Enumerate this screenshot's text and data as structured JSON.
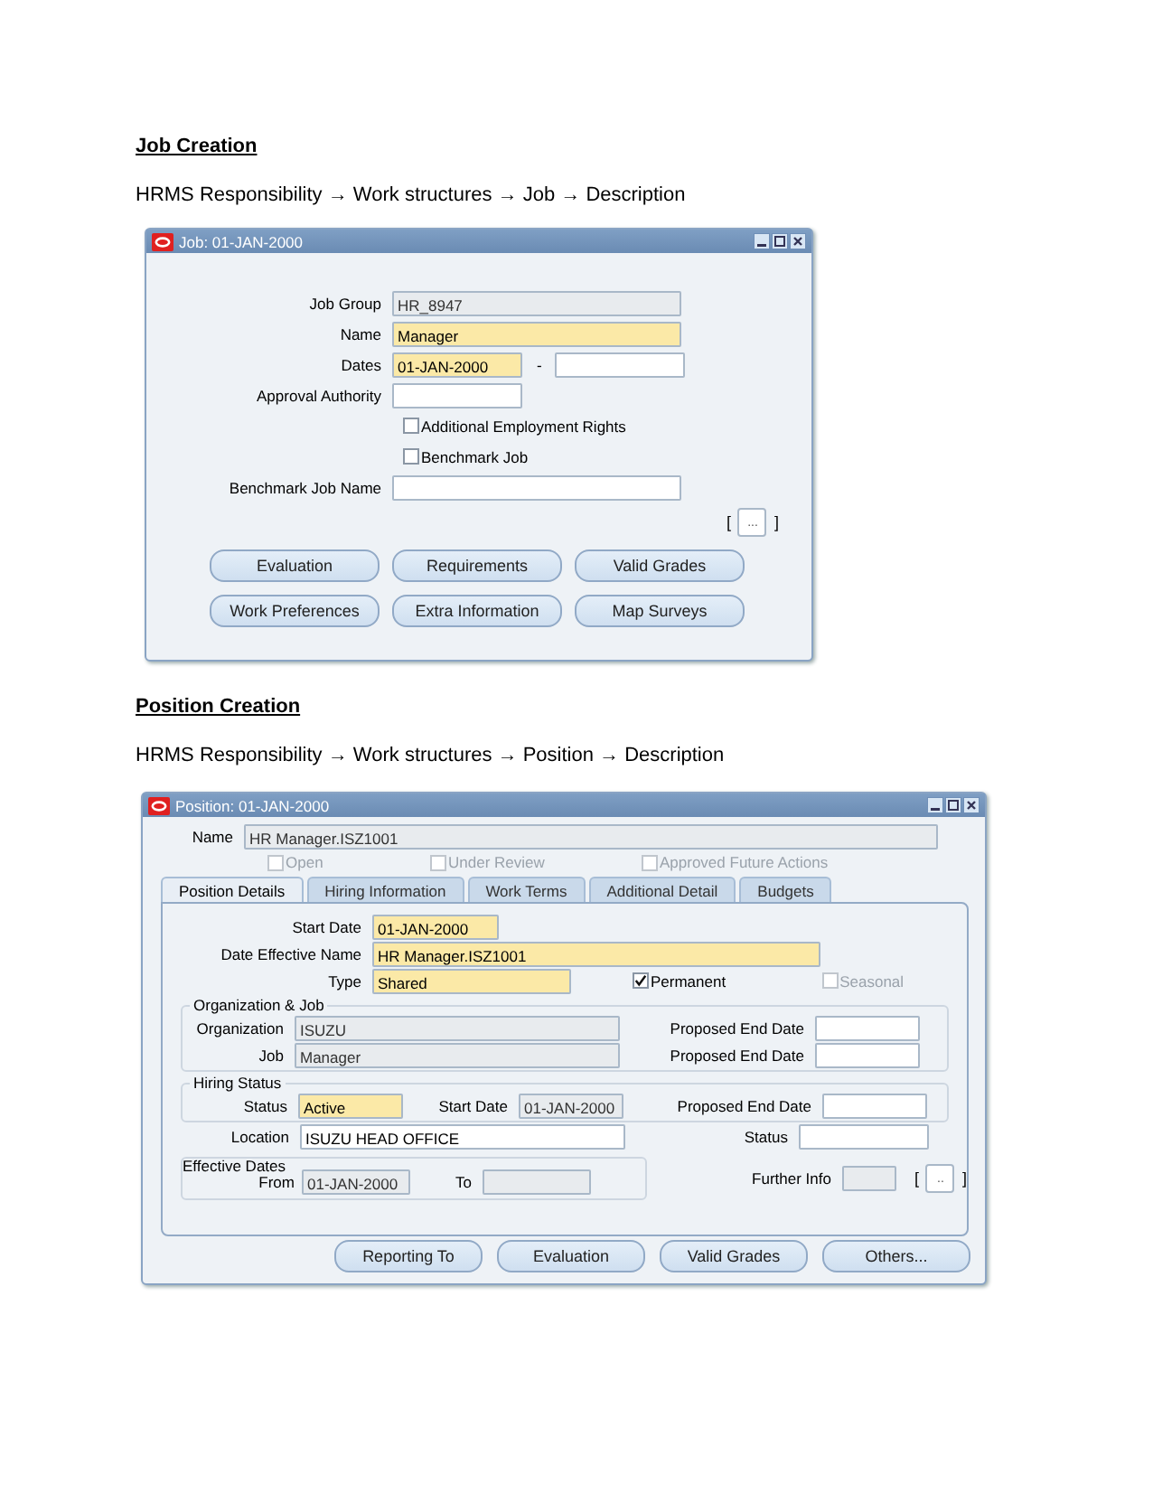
{
  "job_section": {
    "heading": "Job Creation",
    "path": "HRMS Responsibility → Work structures → Job → Description"
  },
  "job_window": {
    "title": "Job: 01-JAN-2000",
    "fields": [
      {
        "label": "Job Group",
        "value": "HR_8947",
        "kind": "readonly"
      },
      {
        "label": "Name",
        "value": "Manager",
        "kind": "required"
      },
      {
        "label": "Dates",
        "value": "01-JAN-2000",
        "kind": "required"
      },
      {
        "kind": "normal"
      },
      {
        "label": "Approval Authority",
        "kind": "normal"
      },
      {
        "label": "Benchmark Job Name",
        "kind": "normal"
      }
    ],
    "dates_separator": "-",
    "checkboxes": [
      {
        "label": "Additional Employment Rights",
        "checked": false,
        "disabled": false
      },
      {
        "label": "Benchmark Job",
        "checked": false,
        "disabled": false
      }
    ],
    "lov": {
      "open": "[",
      "label": "...",
      "close": "]"
    },
    "buttons": [
      "Evaluation",
      "Requirements",
      "Valid Grades",
      "Work Preferences",
      "Extra Information",
      "Map Surveys"
    ]
  },
  "position_section": {
    "heading": "Position Creation",
    "path": "HRMS Responsibility → Work structures → Position → Description"
  },
  "position_window": {
    "title": "Position: 01-JAN-2000",
    "name": {
      "label": "Name",
      "value": "HR Manager.ISZ1001",
      "kind": "readonly"
    },
    "flags": [
      {
        "label": "Open",
        "checked": false,
        "disabled": true
      },
      {
        "label": "Under Review",
        "checked": false,
        "disabled": true
      },
      {
        "label": "Approved Future Actions",
        "checked": false,
        "disabled": true
      }
    ],
    "tabs": [
      {
        "label": "Position Details",
        "selected": true
      },
      {
        "label": "Hiring Information",
        "selected": false
      },
      {
        "label": "Work Terms",
        "selected": false
      },
      {
        "label": "Additional Detail",
        "selected": false
      },
      {
        "label": "Budgets",
        "selected": false
      }
    ],
    "details": [
      {
        "label": "Start Date",
        "value": "01-JAN-2000",
        "kind": "required"
      },
      {
        "label": "Date Effective Name",
        "value": "HR Manager.ISZ1001",
        "kind": "required"
      },
      {
        "label": "Type",
        "value": "Shared",
        "kind": "required"
      }
    ],
    "type_checkboxes": [
      {
        "label": "Permanent",
        "checked": true,
        "disabled": false
      },
      {
        "label": "Seasonal",
        "checked": false,
        "disabled": true
      }
    ],
    "org_group": {
      "title": "Organization & Job",
      "fields": [
        {
          "label": "Organization",
          "value": "ISUZU",
          "kind": "readonly"
        },
        {
          "label": "Proposed End Date",
          "kind": "normal"
        },
        {
          "label": "Job",
          "value": "Manager",
          "kind": "readonly"
        },
        {
          "label": "Proposed End Date",
          "kind": "normal"
        }
      ]
    },
    "hiring_group": {
      "title": "Hiring Status",
      "fields": [
        {
          "label": "Status",
          "value": "Active",
          "kind": "required"
        },
        {
          "label": "Start Date",
          "value": "01-JAN-2000",
          "kind": "readonly"
        },
        {
          "label": "Proposed End Date",
          "kind": "normal"
        }
      ]
    },
    "location": {
      "label": "Location",
      "value": "ISUZU HEAD OFFICE",
      "kind": "normal"
    },
    "status": {
      "label": "Status",
      "kind": "normal"
    },
    "effective_dates": {
      "title": "Effective Dates",
      "fields": [
        {
          "label": "From",
          "value": "01-JAN-2000",
          "kind": "readonly"
        },
        {
          "label": "To",
          "kind": "readonly"
        }
      ]
    },
    "further_info": {
      "label": "Further Info",
      "kind": "readonly"
    },
    "lov": {
      "open": "[",
      "label": "..",
      "close": "]"
    },
    "buttons": [
      "Reporting To",
      "Evaluation",
      "Valid Grades",
      "Others..."
    ]
  }
}
